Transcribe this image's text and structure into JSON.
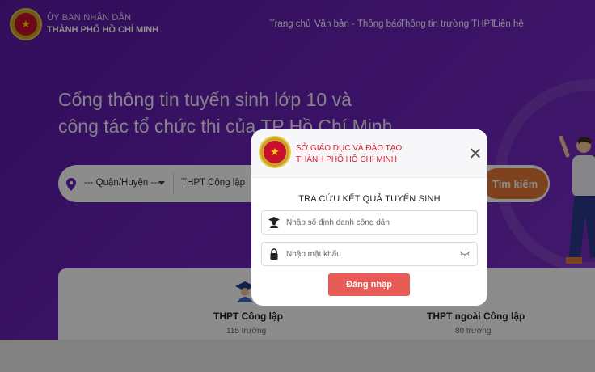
{
  "header": {
    "org_line1": "ỦY BAN NHÂN DÂN",
    "org_line2": "THÀNH PHỐ HỒ CHÍ MINH",
    "nav": [
      "Trang chủ",
      "Văn bản - Thông báo",
      "Thông tin trường THPT",
      "Liên hệ"
    ]
  },
  "hero": {
    "title_line1": "Cổng thông tin tuyển sinh lớp 10 và",
    "title_line2": "công tác tổ chức thi của TP Hồ Chí Minh"
  },
  "search": {
    "district_placeholder": "--- Quận/Huyện ---",
    "school_type": "THPT Công lập",
    "button_label": "Tìm kiếm"
  },
  "cards": [
    {
      "title": "THPT Công lập",
      "count": "115 trường"
    },
    {
      "title": "THPT ngoài Công lập",
      "count": "80 trường"
    }
  ],
  "modal": {
    "org_line1": "SỞ GIÁO DỤC VÀ ĐÀO TẠO",
    "org_line2": "THÀNH PHỐ HỒ CHÍ MINH",
    "title": "TRA CỨU KẾT QUẢ TUYỂN SINH",
    "id_placeholder": "Nhập số định danh công dân",
    "password_placeholder": "Nhập mật khẩu",
    "login_label": "Đăng nhập"
  },
  "colors": {
    "hero_purple": "#6a22b8",
    "search_orange": "#e8793a",
    "login_red": "#e85a56",
    "modal_org_red": "#d0202b"
  }
}
